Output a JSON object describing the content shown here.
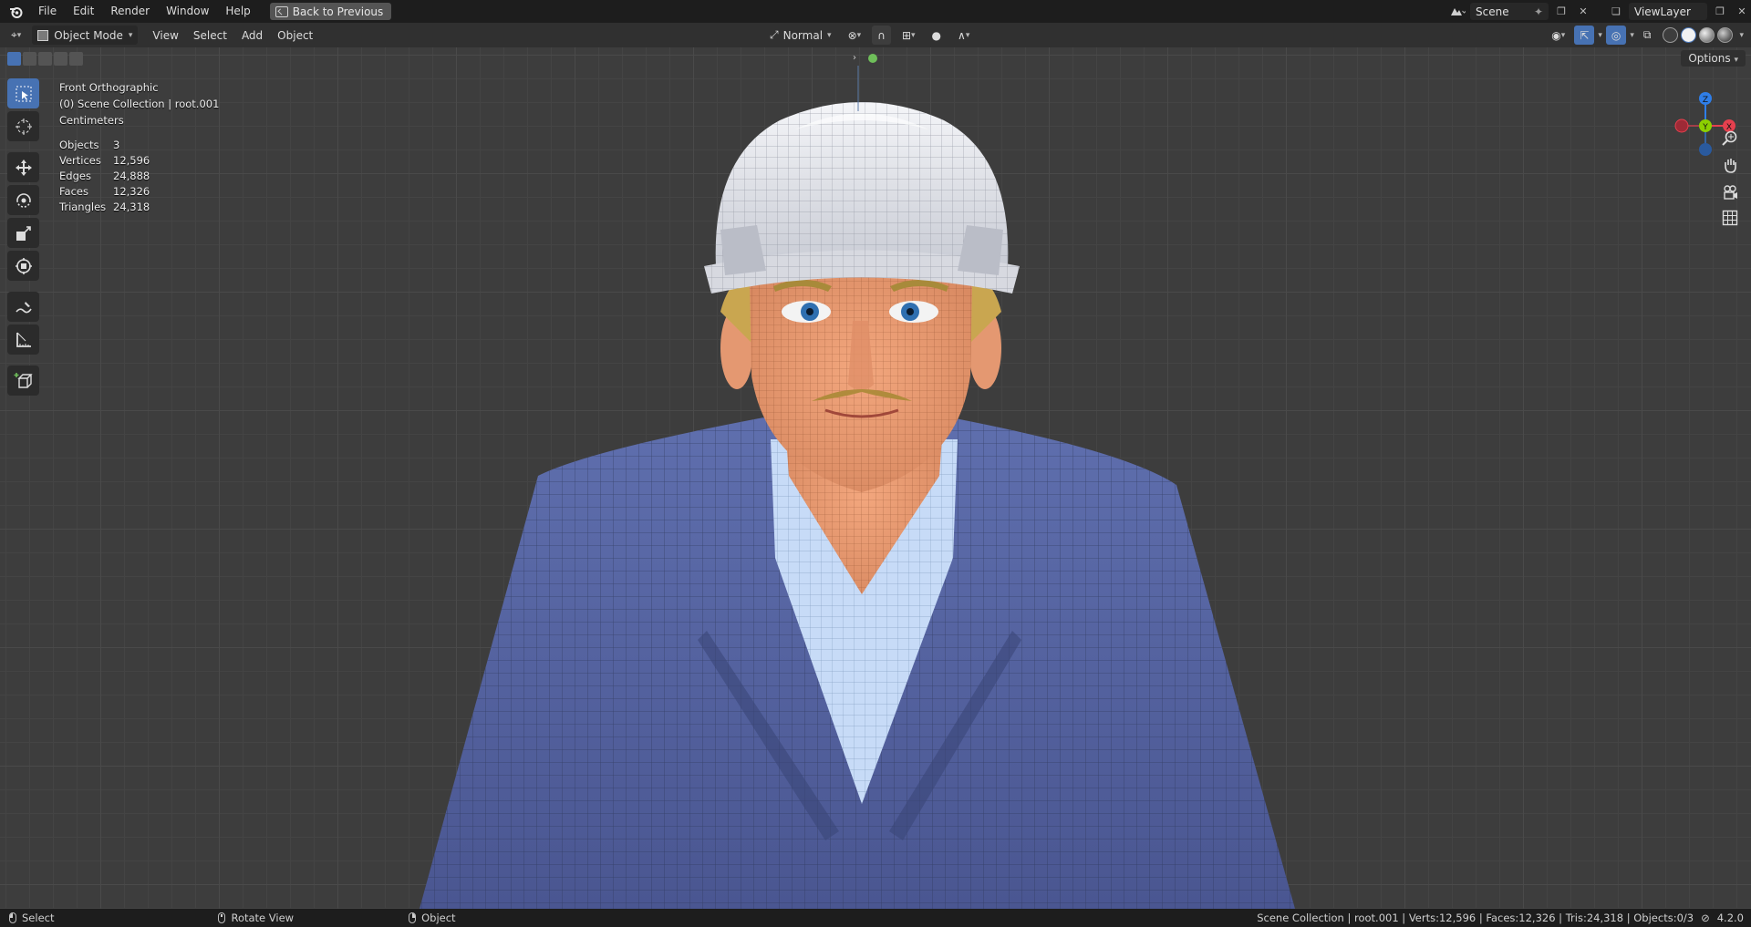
{
  "app": {
    "name": "Blender",
    "version": "4.2.0"
  },
  "menu": {
    "items": [
      "File",
      "Edit",
      "Render",
      "Window",
      "Help"
    ],
    "back_button": "Back to Previous"
  },
  "top_right": {
    "scene": "Scene",
    "view_layer": "ViewLayer"
  },
  "header": {
    "mode": "Object Mode",
    "menus": [
      "View",
      "Select",
      "Add",
      "Object"
    ],
    "transform_orientation": "Normal",
    "options_label": "Options"
  },
  "overlay": {
    "view_name": "Front Orthographic",
    "collection": "(0) Scene Collection | root.001",
    "units": "Centimeters",
    "stats": [
      {
        "label": "Objects",
        "value": "3"
      },
      {
        "label": "Vertices",
        "value": "12,596"
      },
      {
        "label": "Edges",
        "value": "24,888"
      },
      {
        "label": "Faces",
        "value": "12,326"
      },
      {
        "label": "Triangles",
        "value": "24,318"
      }
    ]
  },
  "gizmo": {
    "z": "Z",
    "y": "Y",
    "x": "X"
  },
  "statusbar": {
    "select": "Select",
    "rotate": "Rotate View",
    "object": "Object",
    "info": "Scene Collection | root.001 | Verts:12,596 | Faces:12,326 | Tris:24,318 | Objects:0/3",
    "version": "4.2.0"
  },
  "colors": {
    "accent": "#4772b3",
    "viewport_bg": "#3d3d3d",
    "topbar_bg": "#1d1d1d",
    "header_bg": "#303030",
    "axis_x": "#e5404e",
    "axis_y": "#8cd000",
    "axis_z": "#2f7ee8"
  },
  "icons": {
    "tools": [
      "select-box-icon",
      "cursor-icon",
      "move-icon",
      "rotate-icon",
      "scale-icon",
      "transform-icon",
      "annotate-icon",
      "measure-icon",
      "add-cube-icon"
    ],
    "nav": [
      "zoom-icon",
      "pan-hand-icon",
      "camera-icon",
      "grid-icon"
    ]
  }
}
